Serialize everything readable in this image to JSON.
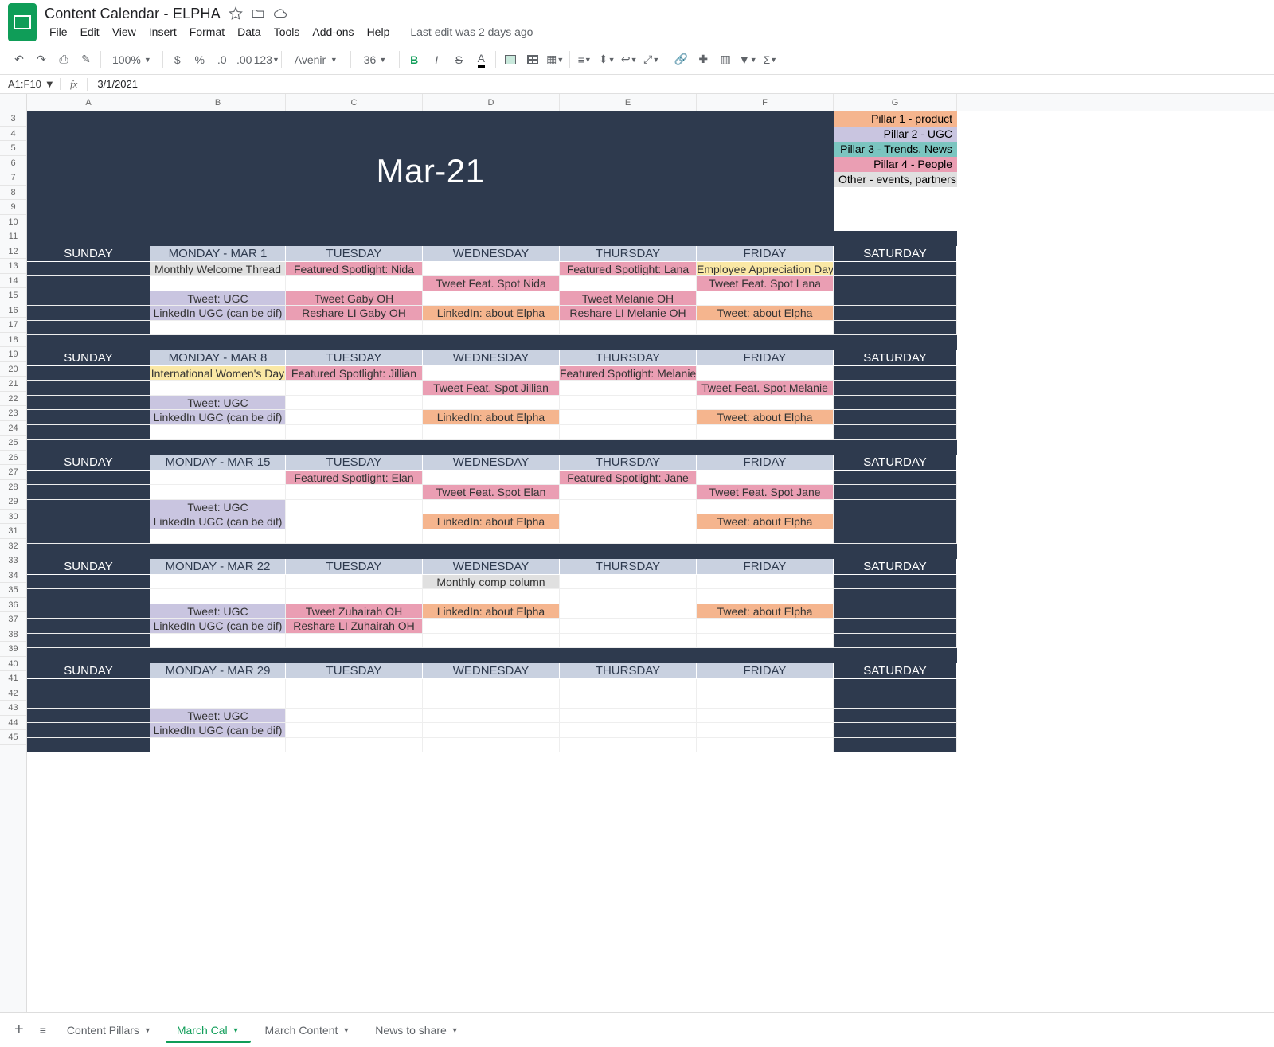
{
  "doc_title": "Content Calendar - ELPHA",
  "menus": [
    "File",
    "Edit",
    "View",
    "Insert",
    "Format",
    "Data",
    "Tools",
    "Add-ons",
    "Help"
  ],
  "last_edit": "Last edit was 2 days ago",
  "toolbar": {
    "zoom": "100%",
    "font": "Avenir",
    "size": "36"
  },
  "cell_ref": "A1:F10",
  "formula_value": "3/1/2021",
  "columns": [
    "A",
    "B",
    "C",
    "D",
    "E",
    "F",
    "G"
  ],
  "hero_title": "Mar-21",
  "legend": [
    {
      "label": "Pillar 1 - product",
      "cls": "p1"
    },
    {
      "label": "Pillar 2 - UGC",
      "cls": "p2"
    },
    {
      "label": "Pillar 3 - Trends, News",
      "cls": "p3"
    },
    {
      "label": "Pillar 4 - People",
      "cls": "p4"
    },
    {
      "label": "Other - events, partners",
      "cls": "p5"
    }
  ],
  "day_labels": {
    "sun": "SUNDAY",
    "sat": "SATURDAY",
    "tue": "TUESDAY",
    "wed": "WEDNESDAY",
    "thu": "THURSDAY",
    "fri": "FRIDAY"
  },
  "weeks": [
    {
      "monday": "MONDAY - MAR 1",
      "rows": [
        [
          null,
          {
            "t": "Monthly Welcome Thread",
            "c": "p5"
          },
          {
            "t": "Featured Spotlight: Nida",
            "c": "p4"
          },
          null,
          {
            "t": "Featured Spotlight: Lana",
            "c": "p4"
          },
          {
            "t": "Employee Appreciation Day",
            "c": "yellow"
          },
          null
        ],
        [
          null,
          null,
          null,
          {
            "t": "Tweet Feat. Spot Nida",
            "c": "p4"
          },
          null,
          {
            "t": "Tweet Feat. Spot Lana",
            "c": "p4"
          },
          null
        ],
        [
          null,
          {
            "t": "Tweet: UGC",
            "c": "p2"
          },
          {
            "t": "Tweet Gaby OH",
            "c": "p4"
          },
          null,
          {
            "t": "Tweet Melanie OH",
            "c": "p4"
          },
          null,
          null
        ],
        [
          null,
          {
            "t": "LinkedIn UGC (can be dif)",
            "c": "p2"
          },
          {
            "t": "Reshare LI Gaby OH",
            "c": "p4"
          },
          {
            "t": "LinkedIn: about Elpha",
            "c": "p1"
          },
          {
            "t": "Reshare LI Melanie OH",
            "c": "p4"
          },
          {
            "t": "Tweet: about Elpha",
            "c": "p1"
          },
          null
        ],
        [
          null,
          null,
          null,
          null,
          null,
          null,
          null
        ]
      ]
    },
    {
      "monday": "MONDAY - MAR 8",
      "rows": [
        [
          null,
          {
            "t": "International Women's Day",
            "c": "yellow"
          },
          {
            "t": "Featured Spotlight: Jillian",
            "c": "p4"
          },
          null,
          {
            "t": "Featured Spotlight: Melanie",
            "c": "p4"
          },
          null,
          null
        ],
        [
          null,
          null,
          null,
          {
            "t": "Tweet Feat. Spot Jillian",
            "c": "p4"
          },
          null,
          {
            "t": "Tweet Feat. Spot Melanie",
            "c": "p4"
          },
          null
        ],
        [
          null,
          {
            "t": "Tweet: UGC",
            "c": "p2"
          },
          null,
          null,
          null,
          null,
          null
        ],
        [
          null,
          {
            "t": "LinkedIn UGC (can be dif)",
            "c": "p2"
          },
          null,
          {
            "t": "LinkedIn: about Elpha",
            "c": "p1"
          },
          null,
          {
            "t": "Tweet: about Elpha",
            "c": "p1"
          },
          null
        ],
        [
          null,
          null,
          null,
          null,
          null,
          null,
          null
        ]
      ]
    },
    {
      "monday": "MONDAY - MAR 15",
      "rows": [
        [
          null,
          null,
          {
            "t": "Featured Spotlight: Elan",
            "c": "p4"
          },
          null,
          {
            "t": "Featured Spotlight: Jane",
            "c": "p4"
          },
          null,
          null
        ],
        [
          null,
          null,
          null,
          {
            "t": "Tweet Feat. Spot Elan",
            "c": "p4"
          },
          null,
          {
            "t": "Tweet Feat. Spot Jane",
            "c": "p4"
          },
          null
        ],
        [
          null,
          {
            "t": "Tweet: UGC",
            "c": "p2"
          },
          null,
          null,
          null,
          null,
          null
        ],
        [
          null,
          {
            "t": "LinkedIn UGC (can be dif)",
            "c": "p2"
          },
          null,
          {
            "t": "LinkedIn: about Elpha",
            "c": "p1"
          },
          null,
          {
            "t": "Tweet: about Elpha",
            "c": "p1"
          },
          null
        ],
        [
          null,
          null,
          null,
          null,
          null,
          null,
          null
        ]
      ]
    },
    {
      "monday": "MONDAY - MAR 22",
      "rows": [
        [
          null,
          null,
          null,
          {
            "t": "Monthly comp column",
            "c": "p5"
          },
          null,
          null,
          null
        ],
        [
          null,
          null,
          null,
          null,
          null,
          null,
          null
        ],
        [
          null,
          {
            "t": "Tweet: UGC",
            "c": "p2"
          },
          {
            "t": "Tweet Zuhairah OH",
            "c": "p4"
          },
          {
            "t": "LinkedIn: about Elpha",
            "c": "p1"
          },
          null,
          {
            "t": "Tweet: about Elpha",
            "c": "p1"
          },
          null
        ],
        [
          null,
          {
            "t": "LinkedIn UGC (can be dif)",
            "c": "p2"
          },
          {
            "t": "Reshare LI Zuhairah OH",
            "c": "p4"
          },
          null,
          null,
          null,
          null
        ],
        [
          null,
          null,
          null,
          null,
          null,
          null,
          null
        ]
      ]
    },
    {
      "monday": "MONDAY - MAR 29",
      "rows": [
        [
          null,
          null,
          null,
          null,
          null,
          null,
          null
        ],
        [
          null,
          null,
          null,
          null,
          null,
          null,
          null
        ],
        [
          null,
          {
            "t": "Tweet: UGC",
            "c": "p2"
          },
          null,
          null,
          null,
          null,
          null
        ],
        [
          null,
          {
            "t": "LinkedIn UGC (can be dif)",
            "c": "p2"
          },
          null,
          null,
          null,
          null,
          null
        ],
        [
          null,
          null,
          null,
          null,
          null,
          null,
          null
        ]
      ]
    }
  ],
  "tabs": [
    {
      "label": "Content Pillars",
      "active": false
    },
    {
      "label": "March Cal",
      "active": true
    },
    {
      "label": "March Content",
      "active": false
    },
    {
      "label": "News to share",
      "active": false
    }
  ]
}
